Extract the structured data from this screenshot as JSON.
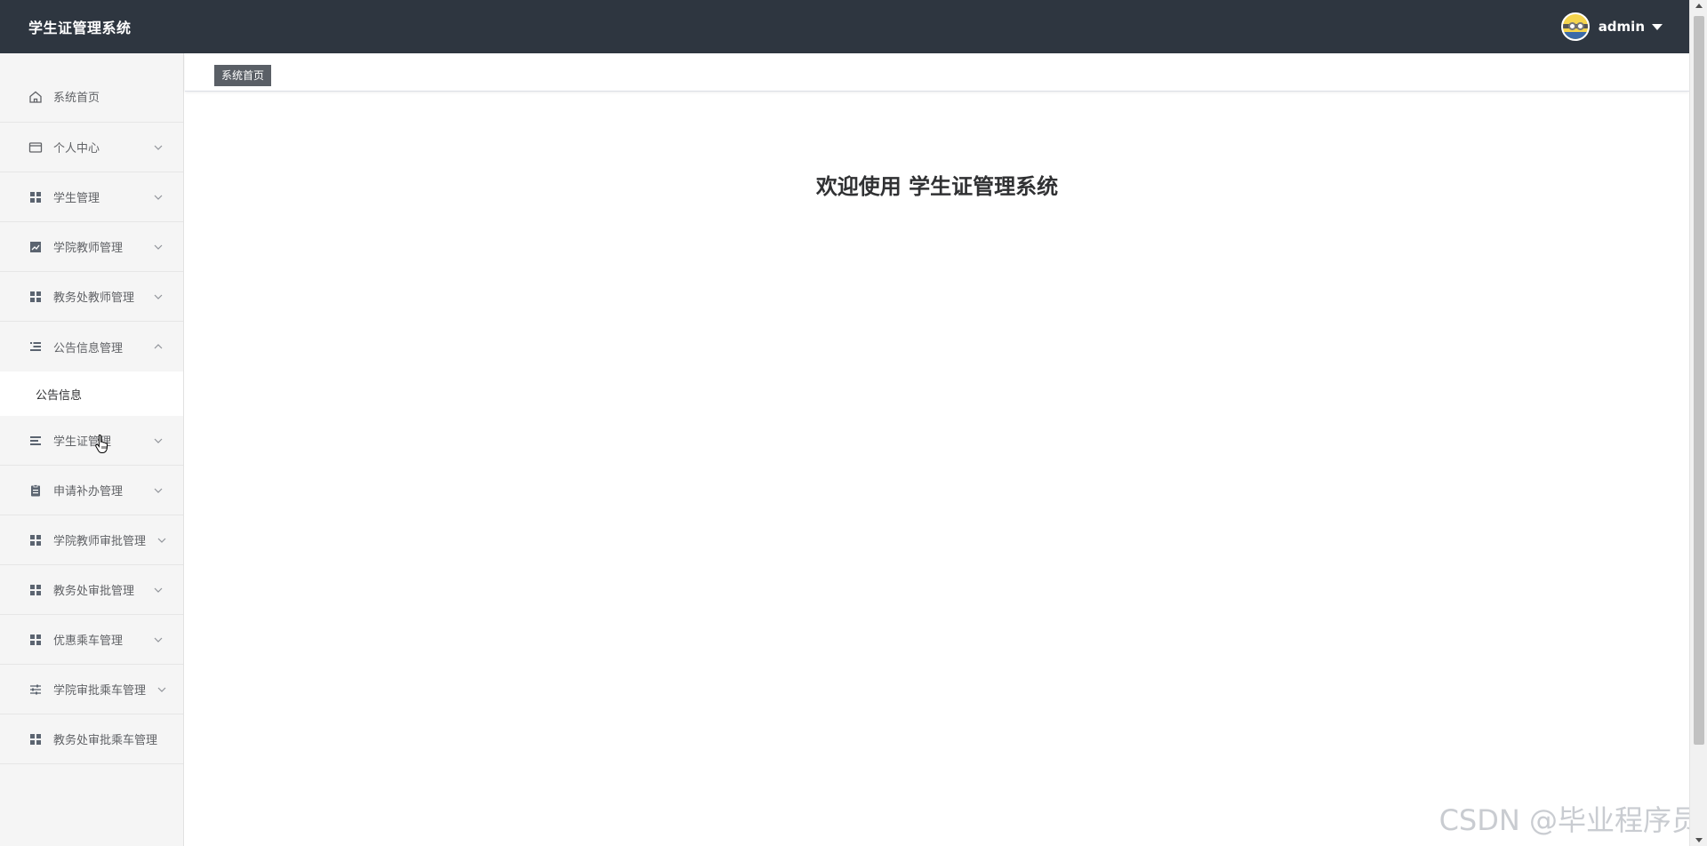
{
  "header": {
    "brand": "学生证管理系统",
    "username": "admin",
    "avatar_icon": "minion-avatar",
    "bg_color": "#2e3640"
  },
  "sidebar": {
    "items": [
      {
        "label": "系统首页",
        "icon": "home-icon"
      },
      {
        "label": "个人中心",
        "icon": "card-icon"
      },
      {
        "label": "学生管理",
        "icon": "grid-icon"
      },
      {
        "label": "学院教师管理",
        "icon": "chart-icon"
      },
      {
        "label": "教务处教师管理",
        "icon": "grid-icon"
      },
      {
        "label": "公告信息管理",
        "icon": "list-icon",
        "expanded": true,
        "children": [
          {
            "label": "公告信息"
          }
        ]
      },
      {
        "label": "学生证管理",
        "icon": "menu-lines-icon"
      },
      {
        "label": "申请补办管理",
        "icon": "clipboard-icon"
      },
      {
        "label": "学院教师审批管理",
        "icon": "grid-icon"
      },
      {
        "label": "教务处审批管理",
        "icon": "grid-icon"
      },
      {
        "label": "优惠乘车管理",
        "icon": "grid-icon"
      },
      {
        "label": "学院审批乘车管理",
        "icon": "sliders-icon"
      },
      {
        "label": "教务处审批乘车管理",
        "icon": "grid-icon"
      }
    ]
  },
  "tabs": [
    {
      "label": "系统首页"
    }
  ],
  "main": {
    "welcome": "欢迎使用 学生证管理系统"
  },
  "watermark": "CSDN @毕业程序员"
}
